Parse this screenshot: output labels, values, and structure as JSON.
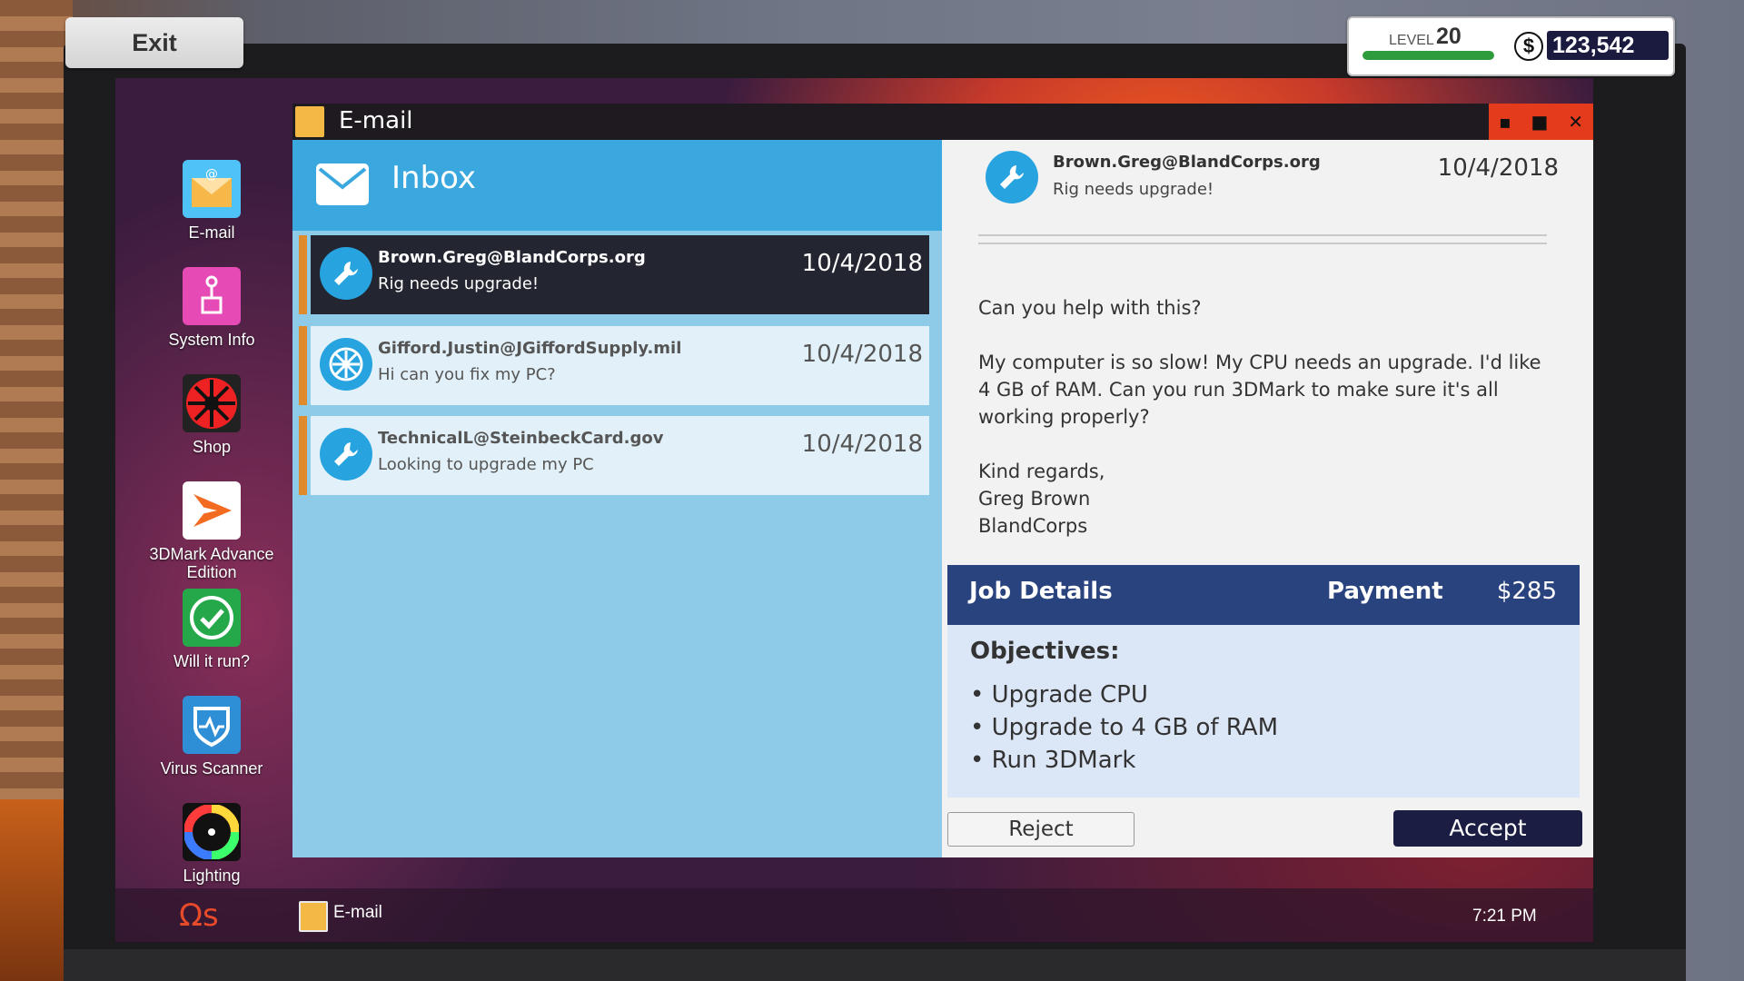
{
  "hud": {
    "exit_label": "Exit",
    "level_label": "LEVEL",
    "level_value": "20",
    "level_progress": 1.0,
    "money": "123,542"
  },
  "desktop": {
    "icons": [
      {
        "label": "E-mail",
        "icon": "email-icon"
      },
      {
        "label": "System Info",
        "icon": "system-info-icon"
      },
      {
        "label": "Shop",
        "icon": "shop-fan-icon"
      },
      {
        "label": "3DMark Advanced Edition",
        "label_line1": "3DMark Advance",
        "label_line2": "Edition",
        "icon": "3dmark-icon"
      },
      {
        "label": "Will it run?",
        "icon": "checkmark-icon"
      },
      {
        "label": "Virus Scanner",
        "icon": "shield-pulse-icon"
      },
      {
        "label": "Lighting",
        "icon": "color-wheel-icon"
      }
    ]
  },
  "window": {
    "title": "E-mail",
    "controls": [
      "minimize",
      "maximize",
      "close"
    ]
  },
  "inbox": {
    "title": "Inbox",
    "messages": [
      {
        "from": "Brown.Greg@BlandCorps.org",
        "subject": "Rig needs upgrade!",
        "date": "10/4/2018",
        "icon": "wrench-icon",
        "selected": true
      },
      {
        "from": "Gifford.Justin@JGiffordSupply.mil",
        "subject": "Hi can you fix my PC?",
        "date": "10/4/2018",
        "icon": "fan-icon",
        "selected": false
      },
      {
        "from": "TechnicalL@SteinbeckCard.gov",
        "subject": "Looking to upgrade my PC",
        "date": "10/4/2018",
        "icon": "wrench-icon",
        "selected": false
      }
    ]
  },
  "reader": {
    "from": "Brown.Greg@BlandCorps.org",
    "subject": "Rig needs upgrade!",
    "date": "10/4/2018",
    "greeting": "Can you help with this?",
    "paragraph": "My computer is so slow! My CPU needs an upgrade. I'd like 4 GB of RAM. Can you run 3DMark to make sure it's all working properly?",
    "signoff": "Kind regards,",
    "signature_name": "Greg Brown",
    "signature_company": "BlandCorps",
    "job_details_label": "Job Details",
    "payment_label": "Payment",
    "payment_value": "$285",
    "objectives_label": "Objectives:",
    "objectives": [
      "• Upgrade CPU",
      "• Upgrade to 4 GB of RAM",
      "• Run 3DMark"
    ],
    "reject_label": "Reject",
    "accept_label": "Accept"
  },
  "taskbar": {
    "logo": "Ωs",
    "app_label": "E-mail",
    "clock": "7:21 PM"
  },
  "colors": {
    "accent_blue": "#3aa7df",
    "job_header": "#29437f",
    "accept_button": "#1b1d43",
    "title_close": "#e43b1c",
    "unread_accent": "#e08a2e"
  }
}
